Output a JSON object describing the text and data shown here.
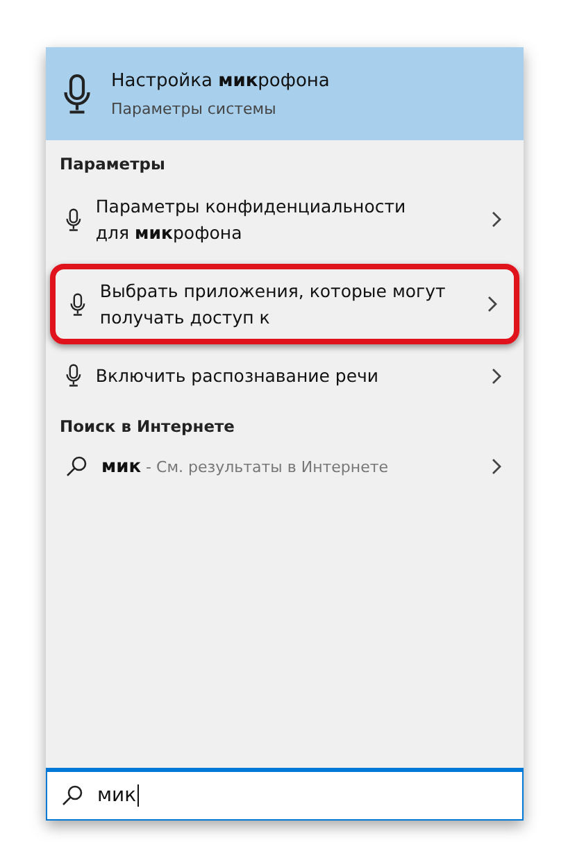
{
  "best_match": {
    "title": "Настройка **мик**рофона",
    "subtitle": "Параметры системы"
  },
  "sections": [
    {
      "header": "Параметры",
      "items": [
        {
          "kind": "mic",
          "text": "Параметры конфиденциальности для **мик**рофона",
          "highlighted": false
        },
        {
          "kind": "mic",
          "text": "Выбрать приложения, которые могут получать доступ к",
          "highlighted": true
        },
        {
          "kind": "mic",
          "text": "Включить распознавание речи",
          "highlighted": false
        }
      ]
    },
    {
      "header": "Поиск в Интернете",
      "items": [
        {
          "kind": "web",
          "text": "**мик** - См. результаты в Интернете",
          "highlighted": false
        }
      ]
    }
  ],
  "search": {
    "value": "мик"
  }
}
